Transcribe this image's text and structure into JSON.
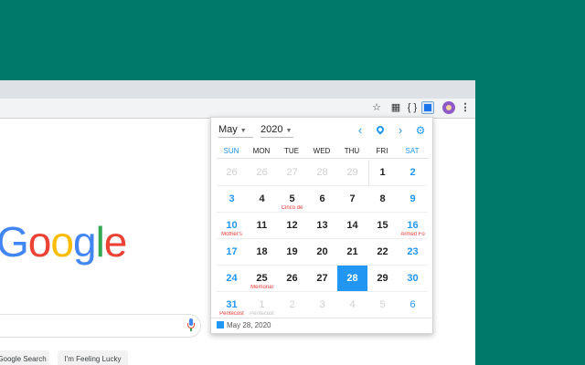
{
  "toolbar": {
    "icons": [
      "star-icon",
      "qr-code-icon",
      "brackets-icon",
      "calendar-extension-icon",
      "profile-avatar-icon",
      "kebab-menu-icon"
    ],
    "star": "☆",
    "brackets": "{ }",
    "menu": "⋮"
  },
  "page": {
    "logo_letters": [
      "G",
      "o",
      "o",
      "g",
      "l",
      "e"
    ],
    "logo_colors": [
      "#4285f4",
      "#ea4335",
      "#fbbc05",
      "#4285f4",
      "#34a853",
      "#ea4335"
    ],
    "search_button": "Google Search",
    "lucky_button": "I'm Feeling Lucky"
  },
  "calendar": {
    "month": "May",
    "year": "2020",
    "weekdays": [
      "SUN",
      "MON",
      "TUE",
      "WED",
      "THU",
      "FRI",
      "SAT"
    ],
    "weeks": [
      [
        {
          "d": "26",
          "o": true
        },
        {
          "d": "26",
          "o": true
        },
        {
          "d": "27",
          "o": true
        },
        {
          "d": "28",
          "o": true
        },
        {
          "d": "29",
          "o": true
        },
        {
          "d": "1"
        },
        {
          "d": "2"
        }
      ],
      [
        {
          "d": "3"
        },
        {
          "d": "4"
        },
        {
          "d": "5",
          "e": "Cinco de"
        },
        {
          "d": "6"
        },
        {
          "d": "7"
        },
        {
          "d": "8"
        },
        {
          "d": "9"
        }
      ],
      [
        {
          "d": "10",
          "e": "Mother's"
        },
        {
          "d": "11"
        },
        {
          "d": "12"
        },
        {
          "d": "13"
        },
        {
          "d": "14"
        },
        {
          "d": "15"
        },
        {
          "d": "16",
          "e": "Armed Fo"
        }
      ],
      [
        {
          "d": "17"
        },
        {
          "d": "18"
        },
        {
          "d": "19"
        },
        {
          "d": "20"
        },
        {
          "d": "21"
        },
        {
          "d": "22"
        },
        {
          "d": "23"
        }
      ],
      [
        {
          "d": "24"
        },
        {
          "d": "25",
          "e": "Memorial"
        },
        {
          "d": "26"
        },
        {
          "d": "27"
        },
        {
          "d": "28",
          "t": true
        },
        {
          "d": "29"
        },
        {
          "d": "30"
        }
      ],
      [
        {
          "d": "31",
          "e": "Pentecost"
        },
        {
          "d": "1",
          "o": true,
          "e": "Pentecost"
        },
        {
          "d": "2",
          "o": true
        },
        {
          "d": "3",
          "o": true
        },
        {
          "d": "4",
          "o": true
        },
        {
          "d": "5",
          "o": true
        },
        {
          "d": "6",
          "o": true
        }
      ]
    ],
    "footer_date": "May 28, 2020",
    "accent": "#2196f3",
    "holiday_color": "#e53935"
  }
}
